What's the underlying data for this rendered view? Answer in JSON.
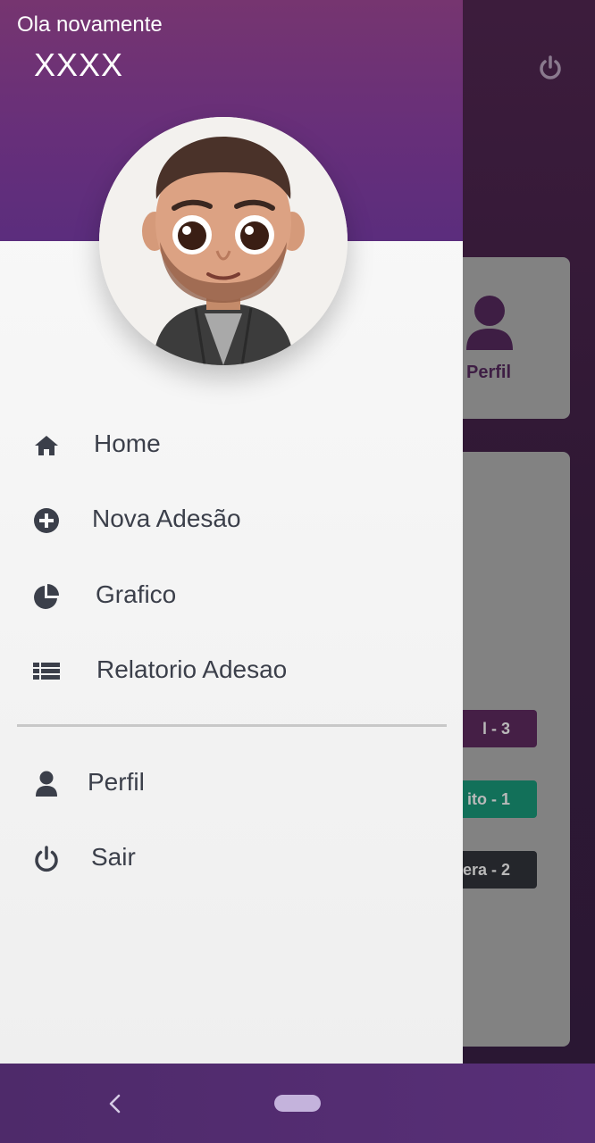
{
  "header": {
    "greeting": "Ola novamente",
    "username": "XXXX"
  },
  "menu": {
    "items": [
      {
        "label": "Home",
        "icon": "home-icon"
      },
      {
        "label": "Nova Adesão",
        "icon": "plus-circle-icon"
      },
      {
        "label": "Grafico",
        "icon": "pie-chart-icon"
      },
      {
        "label": "Relatorio Adesao",
        "icon": "list-icon"
      }
    ],
    "secondary": [
      {
        "label": "Perfil",
        "icon": "user-icon"
      },
      {
        "label": "Sair",
        "icon": "power-icon"
      }
    ]
  },
  "background": {
    "card_label": "Perfil",
    "badges": [
      "l - 3",
      "ito - 1",
      "era - 2"
    ]
  },
  "colors": {
    "header_purple": "#672f7a",
    "menu_text": "#3b3f4a",
    "nav_bar": "#542d72"
  }
}
